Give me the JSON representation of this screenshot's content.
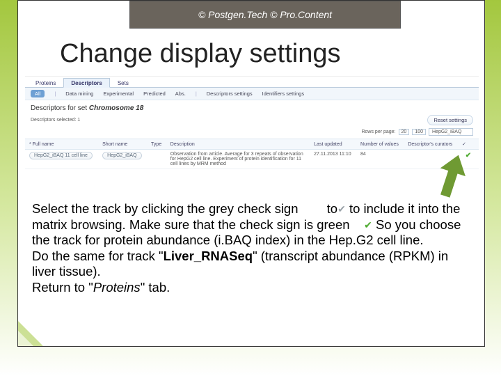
{
  "header": {
    "copyright": "© Postgen.Tech © Pro.Content"
  },
  "title": "Change display settings",
  "app": {
    "tabs": {
      "a": "Proteins",
      "b": "Descriptors",
      "c": "Sets"
    },
    "subtabs": {
      "all": "All",
      "dm": "Data mining",
      "exp": "Experimental",
      "pred": "Predicted",
      "abs": "Abs.",
      "dset": "Descriptors settings",
      "idset": "Identifiers settings"
    },
    "desc_title_prefix": "Descriptors for set ",
    "desc_title_set": "Chromosome 18",
    "reset": "Reset settings",
    "selected_label": "Descriptors selected: 1",
    "rows_label": "Rows per page:",
    "rows_opts": {
      "a": "20",
      "b": "100"
    },
    "search_value": "HepG2_iBAQ",
    "columns": {
      "full": "* Full name",
      "short": "Short name",
      "type": "Type",
      "desc": "Description",
      "updated": "Last updated",
      "nvals": "Number of values",
      "curators": "Descriptor's curators",
      "chk": "✓"
    },
    "row1": {
      "full": "HepG2_iBAQ 11 cell line",
      "short": "HepG2_iBAQ",
      "type": "",
      "desc": "Observation from article. Average for 3 repeats of observation for HepG2 cell line. Experiment of protein identification for 11 cell lines by MRM method",
      "updated": "27.11.2013 11:10",
      "nvals": "84",
      "curators": ""
    }
  },
  "body": {
    "p1a": "Select the track by clicking the grey check sign ",
    "p1b": " to include it into the matrix browsing. Make sure that the check sign is green ",
    "p1c": "So you choose the track for protein abundance (i.BAQ index) in the Hep.G2 cell line.",
    "p2a": "Do the same for track \"",
    "p2b": "Liver_RNASeq",
    "p2c": "\" (transcript abundance (RPKM) in liver tissue).",
    "p3a": "Return to \"",
    "p3b": "Proteins",
    "p3c": "\" tab."
  }
}
